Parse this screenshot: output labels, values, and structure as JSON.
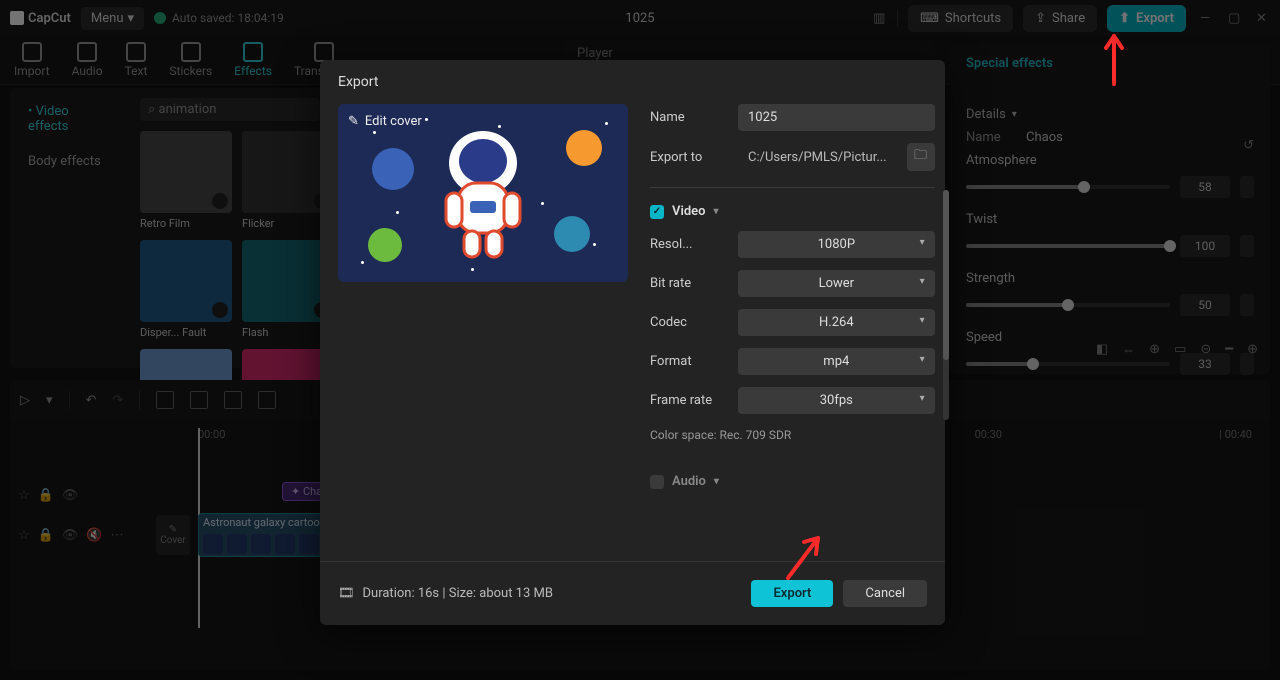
{
  "app": {
    "name": "CapCut",
    "menu": "Menu",
    "autosave": "Auto saved: 18:04:19",
    "title": "1025"
  },
  "topbar": {
    "shortcuts": "Shortcuts",
    "share": "Share",
    "export": "Export"
  },
  "tools": [
    "Import",
    "Audio",
    "Text",
    "Stickers",
    "Effects",
    "Transitions"
  ],
  "effects_panel": {
    "tabs": {
      "video": "• Video effects",
      "body": "Body effects"
    },
    "search": "animation",
    "items": [
      "Retro Film",
      "Flicker",
      "Disper... Fault",
      "Flash",
      "",
      ""
    ]
  },
  "player": {
    "label": "Player"
  },
  "props": {
    "title": "Special effects",
    "details": "Details",
    "name_label": "Name",
    "name_value": "Chaos",
    "sliders": [
      {
        "label": "Atmosphere",
        "value": "58",
        "pct": 58
      },
      {
        "label": "Twist",
        "value": "100",
        "pct": 100
      },
      {
        "label": "Strength",
        "value": "50",
        "pct": 50
      },
      {
        "label": "Speed",
        "value": "33",
        "pct": 33
      }
    ]
  },
  "timeline": {
    "ruler": [
      "00:00",
      "00:30",
      "| 00:40"
    ],
    "effect_clip": "✦ Chao...",
    "video_clip": "Astronaut galaxy cartoon",
    "cover": "Cover"
  },
  "modal": {
    "title": "Export",
    "edit_cover": "Edit cover",
    "name_label": "Name",
    "name_value": "1025",
    "exportto_label": "Export to",
    "exportto_value": "C:/Users/PMLS/Pictur...",
    "video_section": "Video",
    "rows": [
      {
        "label": "Resol...",
        "value": "1080P"
      },
      {
        "label": "Bit rate",
        "value": "Lower"
      },
      {
        "label": "Codec",
        "value": "H.264"
      },
      {
        "label": "Format",
        "value": "mp4"
      },
      {
        "label": "Frame rate",
        "value": "30fps"
      }
    ],
    "color_space": "Color space: Rec. 709 SDR",
    "audio_section": "Audio",
    "duration": "Duration: 16s | Size: about 13 MB",
    "export_btn": "Export",
    "cancel_btn": "Cancel"
  }
}
